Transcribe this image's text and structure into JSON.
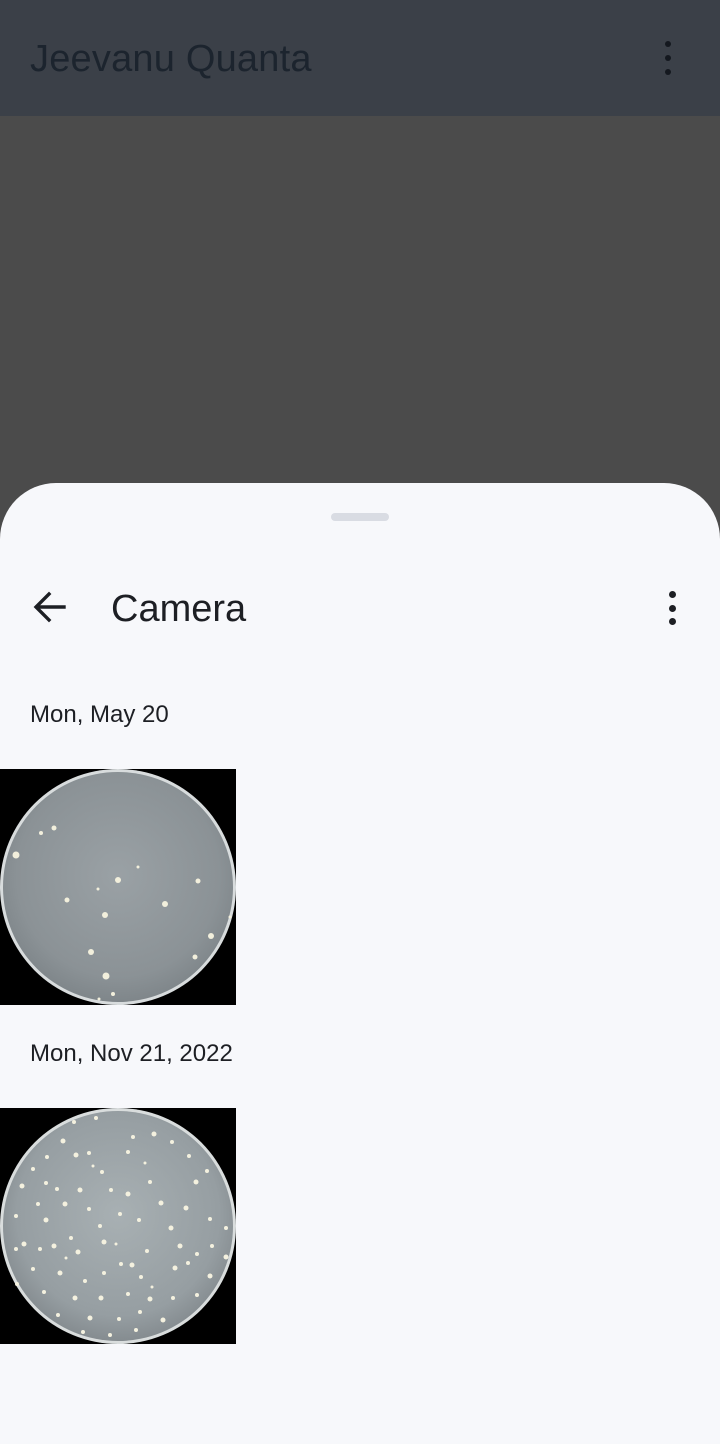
{
  "app_bar": {
    "title": "Jeevanu Quanta",
    "menu_icon": "more-vert-icon"
  },
  "picker_sheet": {
    "title": "Camera",
    "back_icon": "arrow-back-icon",
    "menu_icon": "more-vert-icon",
    "groups": [
      {
        "date": "Mon, May 20",
        "photos": [
          {
            "subject": "petri dish with sparse colonies"
          }
        ]
      },
      {
        "date": "Mon, Nov 21, 2022",
        "photos": [
          {
            "subject": "petri dish with dense colonies"
          }
        ]
      }
    ]
  },
  "colors": {
    "app_bar": "#3b4048",
    "scrim": "#4b4b4b",
    "sheet": "#f7f8fb",
    "text": "#1d1f24"
  }
}
